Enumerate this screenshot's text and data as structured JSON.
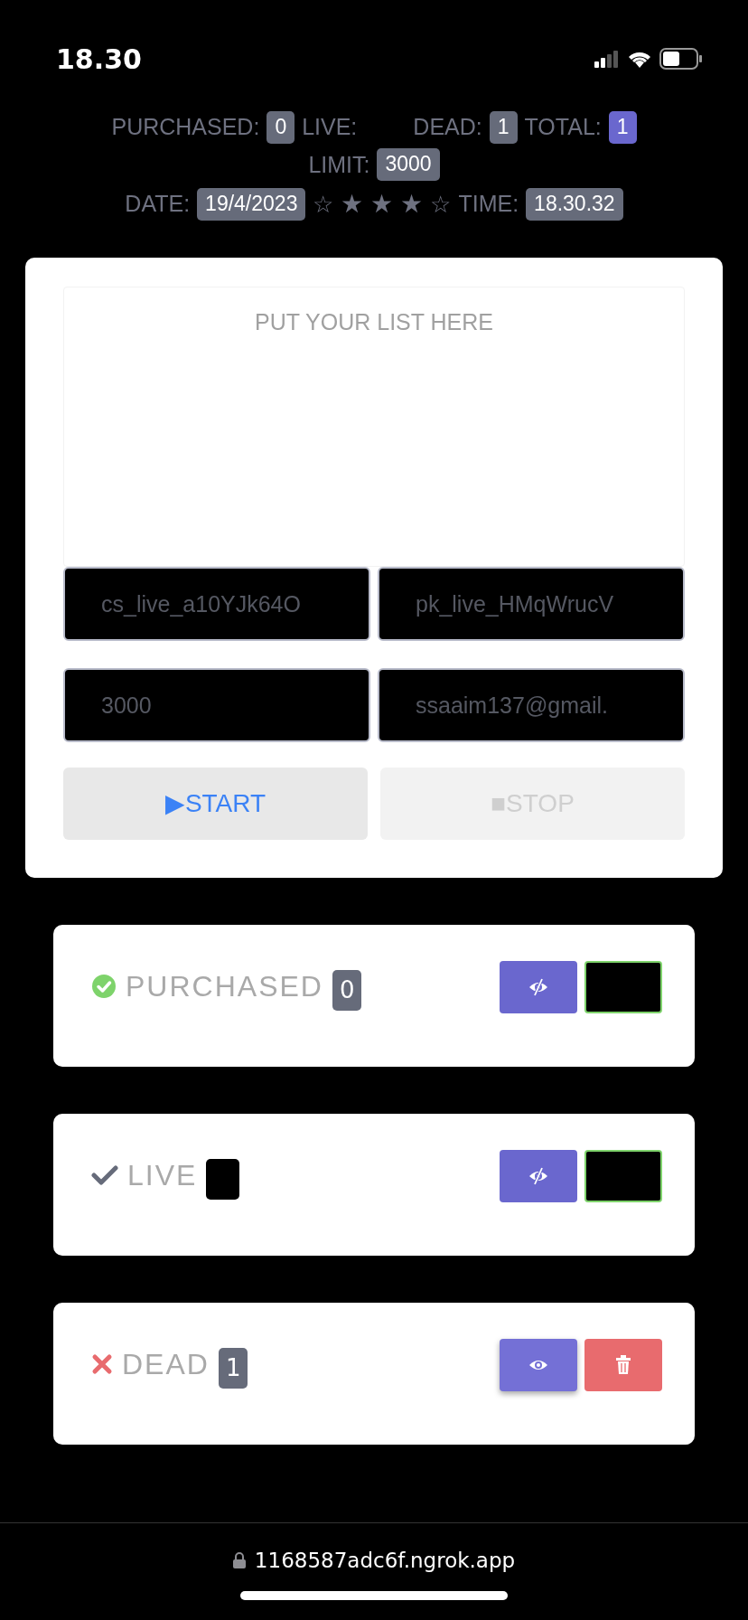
{
  "status_bar": {
    "time": "18.30"
  },
  "header": {
    "counters": [
      {
        "label": "PURCHASED:",
        "value": "0",
        "kind": "gray"
      },
      {
        "label": "LIVE:",
        "kind": "blank"
      },
      {
        "label": "DEAD:",
        "value": "1",
        "kind": "gray"
      },
      {
        "label": "TOTAL:",
        "value": "1",
        "kind": "purple"
      },
      {
        "label": "LIMIT:",
        "value": "3000",
        "kind": "gray"
      }
    ],
    "date_label": "DATE:",
    "date": "19/4/2023",
    "stars": [
      {
        "glyph": "☆",
        "filled": false
      },
      {
        "glyph": "★",
        "filled": true
      },
      {
        "glyph": "★",
        "filled": true
      },
      {
        "glyph": "★",
        "filled": true
      },
      {
        "glyph": "☆",
        "filled": false
      }
    ],
    "time_label": "TIME:",
    "time": "18.30.32"
  },
  "form": {
    "list_placeholder": "PUT YOUR LIST HERE",
    "fields": [
      {
        "value": "cs_live_a10YJk64O"
      },
      {
        "value": "pk_live_HMqWrucV"
      },
      {
        "value": "3000"
      },
      {
        "value": "ssaaim137@gmail."
      }
    ],
    "buttons": [
      {
        "icon": "▶",
        "label": "START",
        "disabled": false
      },
      {
        "icon": "■",
        "label": "STOP",
        "disabled": true
      }
    ]
  },
  "results": [
    {
      "kind": "purchased",
      "title": "PURCHASED",
      "count": "0",
      "buttons": [
        {
          "kind": "hide"
        },
        {
          "kind": "blank"
        }
      ]
    },
    {
      "kind": "live",
      "title": "LIVE",
      "buttons": [
        {
          "kind": "hide"
        },
        {
          "kind": "blank"
        }
      ]
    },
    {
      "kind": "dead",
      "title": "DEAD",
      "count": "1",
      "buttons": [
        {
          "kind": "show"
        },
        {
          "kind": "delete"
        }
      ]
    }
  ],
  "browser": {
    "url": "1168587adc6f.ngrok.app"
  }
}
